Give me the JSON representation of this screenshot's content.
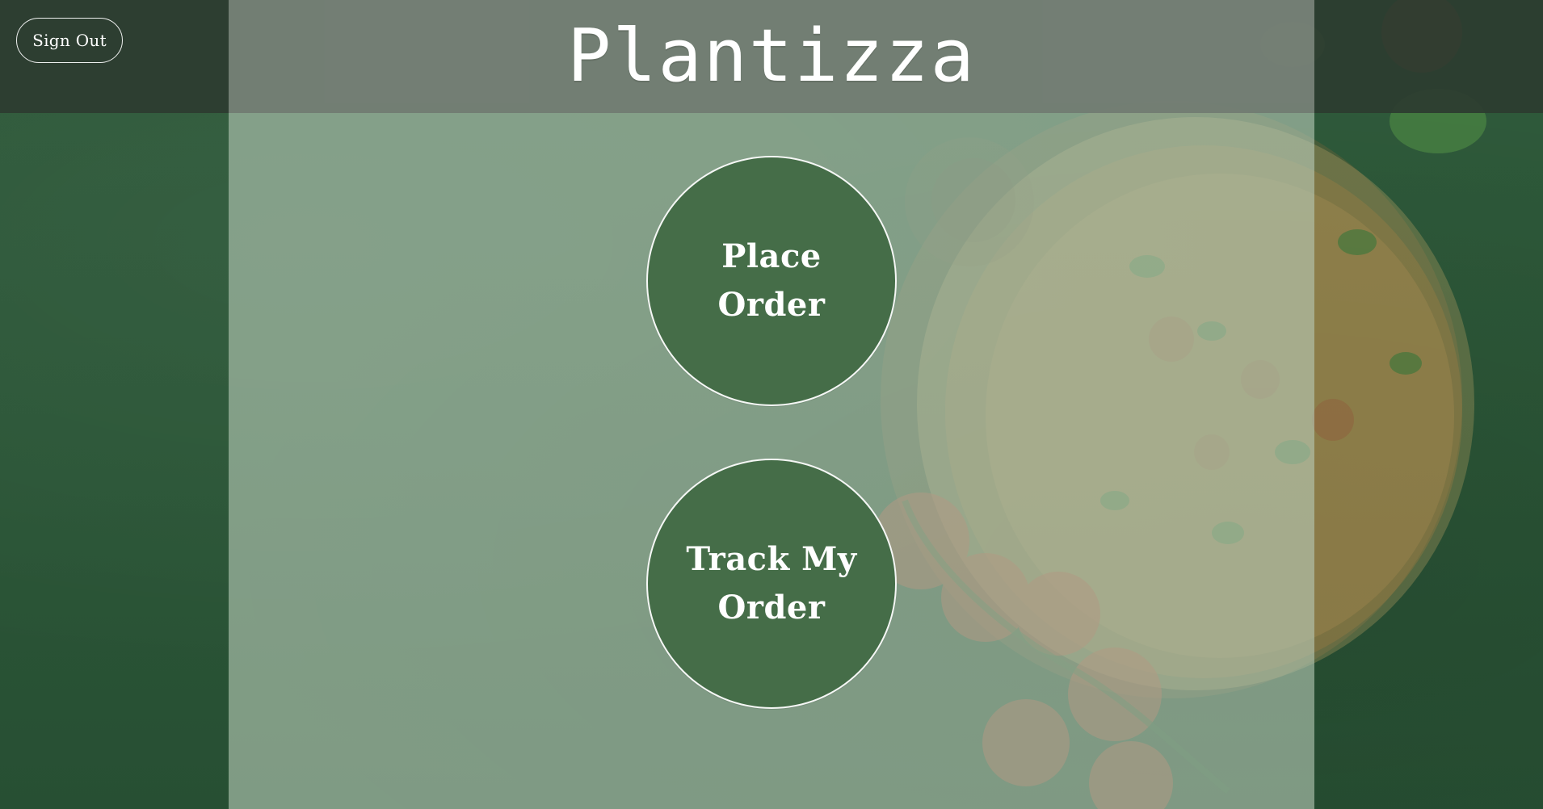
{
  "header": {
    "title": "Plantizza",
    "sign_out_label": "Sign Out"
  },
  "actions": {
    "place_order_label": "Place Order",
    "track_order_label": "Track My Order"
  },
  "colors": {
    "background_green": "#2f5a3b",
    "center_overlay": "#b6cab6",
    "circle_fill": "#456d48",
    "text": "#ffffff"
  },
  "icons": {
    "background": "pizza-illustration"
  }
}
